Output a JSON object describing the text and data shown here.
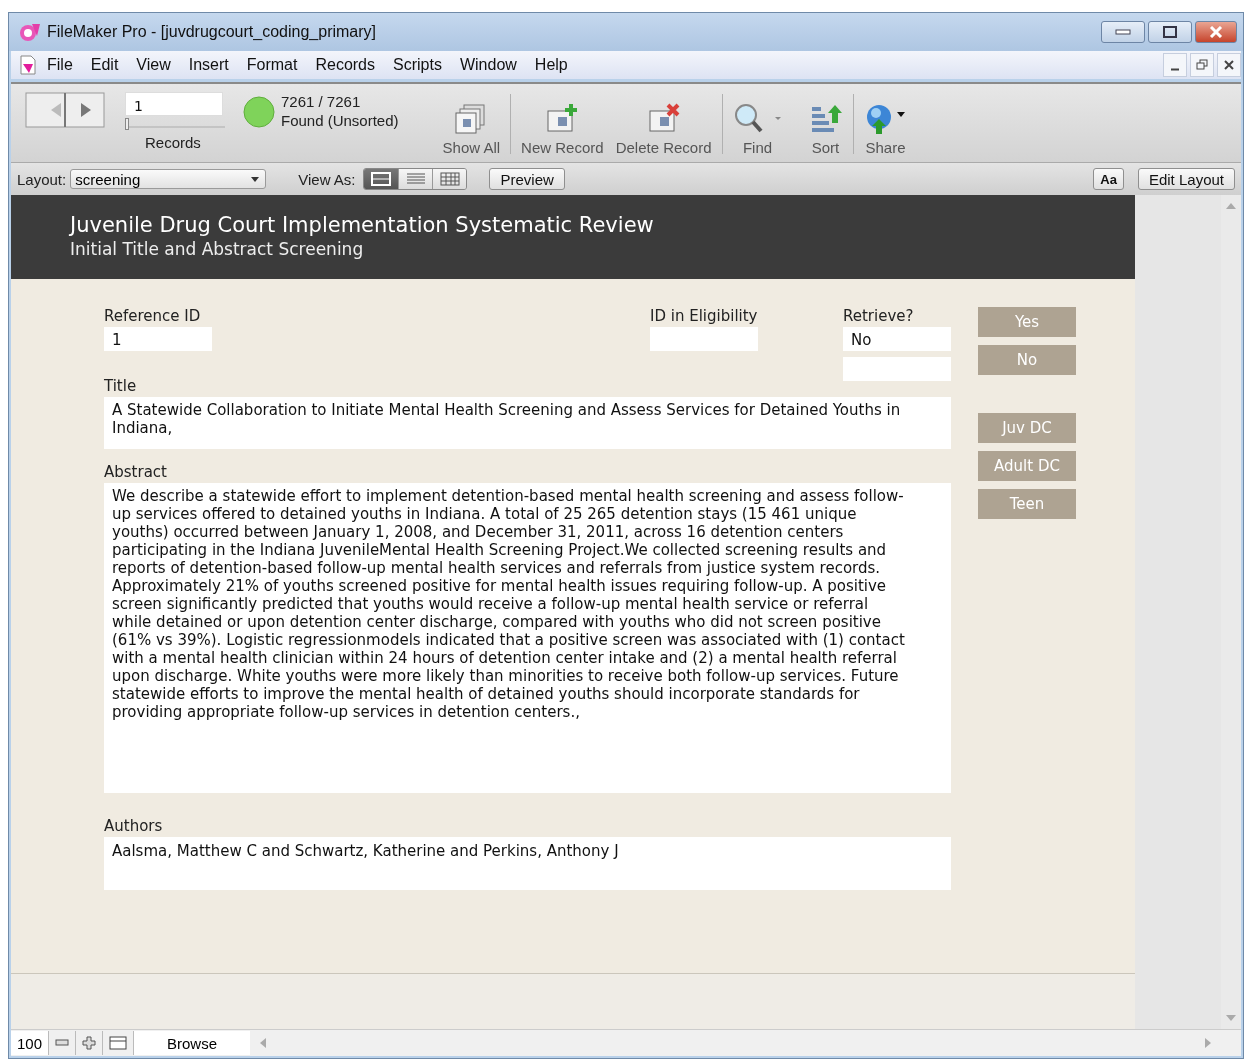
{
  "window": {
    "title": "FileMaker Pro - [juvdrugcourt_coding_primary]"
  },
  "menu": [
    "File",
    "Edit",
    "View",
    "Insert",
    "Format",
    "Records",
    "Scripts",
    "Window",
    "Help"
  ],
  "toolbar": {
    "record_number": "1",
    "records_label": "Records",
    "found_count": "7261 / 7261",
    "found_status": "Found (Unsorted)",
    "slider": {
      "level": 0
    },
    "buttons": [
      {
        "kind": "showall",
        "label": "Show All"
      },
      {
        "kind": "new",
        "label": "New Record"
      },
      {
        "kind": "delete",
        "label": "Delete Record"
      },
      {
        "kind": "find",
        "label": "Find"
      },
      {
        "kind": "sort",
        "label": "Sort"
      },
      {
        "kind": "share",
        "label": "Share"
      }
    ]
  },
  "layout_bar": {
    "layout_label": "Layout:",
    "layout_value": "screening",
    "view_as_label": "View As:",
    "views": [
      {
        "kind": "form",
        "selected": true
      },
      {
        "kind": "list",
        "selected": false
      },
      {
        "kind": "table",
        "selected": false
      }
    ],
    "preview": "Preview",
    "font_button": "Aa",
    "edit_layout": "Edit Layout"
  },
  "header": {
    "title": "Juvenile Drug Court Implementation Systematic Review",
    "subtitle": "Initial Title and Abstract Screening"
  },
  "fields": {
    "reference_id": {
      "label": "Reference ID",
      "value": "1"
    },
    "id_in_eligibility": {
      "label": "ID in Eligibility"
    },
    "retrieve": {
      "label": "Retrieve?",
      "value": "No"
    },
    "title": {
      "label": "Title",
      "value": "A Statewide Collaboration to Initiate Mental Health Screening and Assess Services for Detained Youths in Indiana,"
    },
    "abstract": {
      "label": "Abstract",
      "value": "We describe a statewide effort to implement detention-based mental health screening and assess follow-up services offered to detained youths in Indiana. A total of 25 265 detention stays (15 461 unique youths) occurred between January 1, 2008, and December 31, 2011, across 16 detention centers participating in the Indiana JuvenileMental Health Screening Project.We collected screening results and reports of detention-based follow-up mental health services and referrals from justice system records. Approximately 21% of youths screened positive for mental health issues requiring follow-up. A positive screen significantly predicted that youths would receive a follow-up mental health service or referral while detained or upon detention center discharge, compared with youths who did not screen positive (61% vs 39%). Logistic regressionmodels indicated that a positive screen was associated with (1) contact with a mental health clinician within 24 hours of detention center intake and (2) a mental health referral upon discharge. White youths were more likely than minorities to receive both follow-up services. Future statewide efforts to improve the mental health of detained youths should incorporate standards for providing appropriate follow-up services in detention centers.,"
    },
    "authors": {
      "label": "Authors",
      "value": "Aalsma, Matthew C and Schwartz, Katherine and Perkins, Anthony J"
    }
  },
  "side_button_groups": [
    [
      "Yes",
      "No"
    ],
    [
      "Juv DC",
      "Adult DC",
      "Teen"
    ]
  ],
  "status_bar": {
    "zoom": "100",
    "mode": "Browse"
  }
}
